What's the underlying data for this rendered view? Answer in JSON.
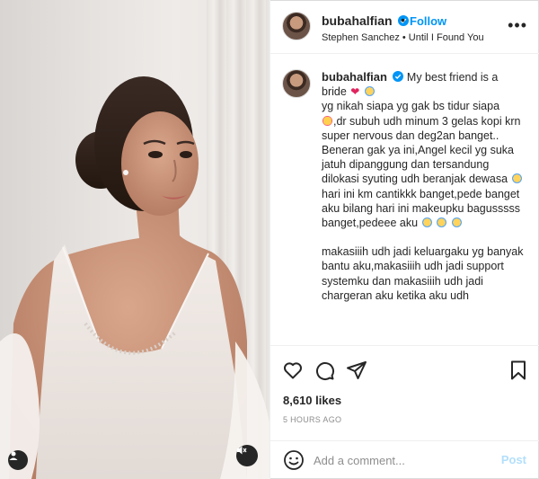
{
  "post": {
    "username": "bubahalfian",
    "follow_label": "Follow",
    "dot": "•",
    "audio": "Stephen Sanchez • Until I Found You",
    "more": "•••",
    "caption_first": "My best friend is a bride",
    "caption_lines": [
      "yg nikah siapa yg gak bs tidur siapa",
      ",dr subuh udh minum 3 gelas kopi krn super nervous dan deg2an banget..",
      "Beneran gak ya ini,Angel kecil yg suka jatuh dipanggung dan tersandung dilokasi syuting udh beranjak dewasa",
      "hari ini km cantikkk banget,pede banget aku bilang hari ini makeupku bagusssss banget,pedeee aku",
      "makasiiih udh jadi keluargaku yg banyak bantu aku,makasiiih udh jadi support systemku dan makasiiih udh jadi chargeran aku ketika aku udh"
    ],
    "likes": "8,610 likes",
    "time_ago": "5 HOURS AGO",
    "comment_placeholder": "Add a comment...",
    "post_label": "Post"
  },
  "colors": {
    "accent": "#0095f6",
    "verified": "#0095f6",
    "post_disabled": "#b2dffc",
    "muted": "#8e8e8e"
  },
  "icons": {
    "like": "heart-icon",
    "comment": "comment-icon",
    "share": "share-icon",
    "save": "bookmark-icon",
    "emoji": "smiley-icon",
    "mute": "speaker-muted-icon",
    "tagged": "user-tag-icon"
  }
}
